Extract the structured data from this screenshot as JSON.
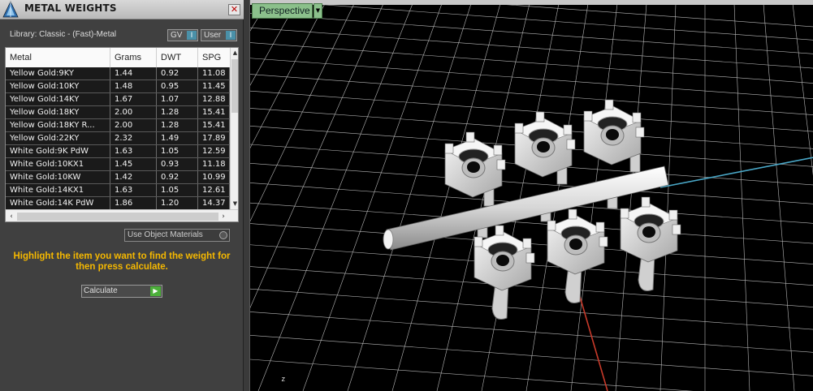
{
  "panel": {
    "title": "METAL WEIGHTS",
    "close_glyph": "✕",
    "library_label": "Library: Classic - (Fast)-Metal",
    "gv_label": "GV",
    "user_label": "User",
    "toggle_glyph": "I",
    "columns": [
      "Metal",
      "Grams",
      "DWT",
      "SPG"
    ],
    "rows": [
      [
        "Yellow Gold:9KY",
        "1.44",
        "0.92",
        "11.08"
      ],
      [
        "Yellow Gold:10KY",
        "1.48",
        "0.95",
        "11.45"
      ],
      [
        "Yellow Gold:14KY",
        "1.67",
        "1.07",
        "12.88"
      ],
      [
        "Yellow Gold:18KY",
        "2.00",
        "1.28",
        "15.41"
      ],
      [
        "Yellow Gold:18KY R...",
        "2.00",
        "1.28",
        "15.41"
      ],
      [
        "Yellow Gold:22KY",
        "2.32",
        "1.49",
        "17.89"
      ],
      [
        "White Gold:9K PdW",
        "1.63",
        "1.05",
        "12.59"
      ],
      [
        "White Gold:10KX1",
        "1.45",
        "0.93",
        "11.18"
      ],
      [
        "White Gold:10KW",
        "1.42",
        "0.92",
        "10.99"
      ],
      [
        "White Gold:14KX1",
        "1.63",
        "1.05",
        "12.61"
      ],
      [
        "White Gold:14K PdW",
        "1.86",
        "1.20",
        "14.37"
      ]
    ],
    "use_object_materials": "Use Object Materials",
    "instruction": "Highlight the item you want to find the weight for then press calculate.",
    "calculate_label": "Calculate",
    "calculate_glyph": "▶"
  },
  "viewport": {
    "view_mode": "Perspective",
    "axis_label": "z",
    "grid_color": "#b8b8b8",
    "x_axis_color": "#4aa8c8",
    "y_axis_color": "#c83a2a",
    "model_color": "#e6e6e6"
  },
  "colors": {
    "instruction": "#f5b800",
    "tab_green": "#8bc08b",
    "toggle_blue": "#4a90a8"
  }
}
